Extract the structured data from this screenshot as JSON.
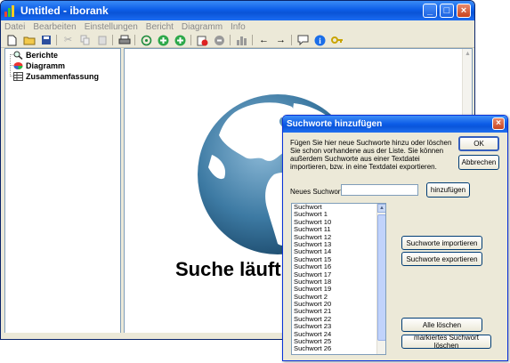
{
  "window": {
    "title": "Untitled - iborank"
  },
  "menu": [
    "Datei",
    "Bearbeiten",
    "Einstellungen",
    "Bericht",
    "Diagramm",
    "Info"
  ],
  "tree": {
    "items": [
      {
        "label": "Berichte",
        "icon": "magnifier-icon"
      },
      {
        "label": "Diagramm",
        "icon": "pie-chart-icon"
      },
      {
        "label": "Zusammenfassung",
        "icon": "table-icon"
      }
    ]
  },
  "content": {
    "status_text": "Suche läuft"
  },
  "dialog": {
    "title": "Suchworte hinzufügen",
    "description": "Fügen Sie hier neue Suchworte hinzu oder löschen Sie schon vorhandene aus der Liste. Sie können außerdem Suchworte aus einer Textdatei importieren, bzw. in eine Textdatei exportieren.",
    "ok_label": "OK",
    "cancel_label": "Abbrechen",
    "new_word_label": "Neues Suchwort:",
    "new_word_value": "",
    "add_label": "hinzufügen",
    "import_label": "Suchworte importieren",
    "export_label": "Suchworte exportieren",
    "clear_all_label": "Alle löschen",
    "delete_selected_label": "markiertes Suchwort löschen",
    "words": [
      "Suchwort",
      "Suchwort 1",
      "Suchwort 10",
      "Suchwort 11",
      "Suchwort 12",
      "Suchwort 13",
      "Suchwort 14",
      "Suchwort 15",
      "Suchwort 16",
      "Suchwort 17",
      "Suchwort 18",
      "Suchwort 19",
      "Suchwort 2",
      "Suchwort 20",
      "Suchwort 21",
      "Suchwort 22",
      "Suchwort 23",
      "Suchwort 24",
      "Suchwort 25",
      "Suchwort 26"
    ]
  },
  "colors": {
    "titlebar": "#0a55da",
    "window_bg": "#ece9d8",
    "close_button": "#c74520"
  }
}
